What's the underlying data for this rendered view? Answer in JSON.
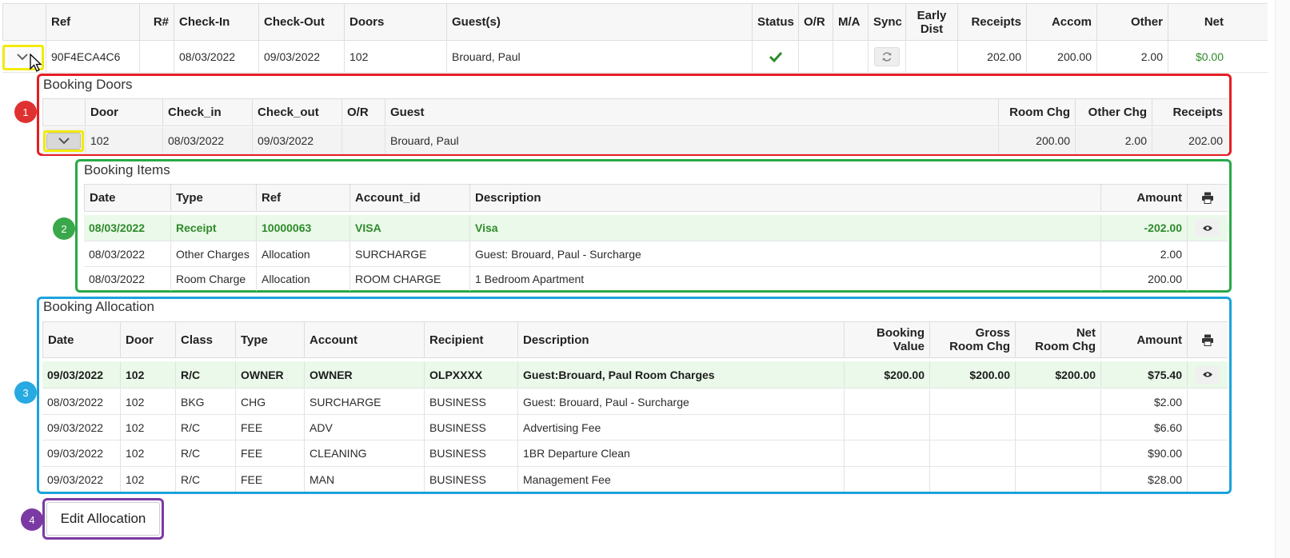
{
  "colors": {
    "red": "#e61d24",
    "green": "#2aa84a",
    "blue": "#1aa3dc",
    "purple": "#7b3aa3",
    "yellow": "#f2ea0c",
    "net_green": "#2f8a2b"
  },
  "main": {
    "headers": {
      "ref": "Ref",
      "rnum": "R#",
      "checkin": "Check-In",
      "checkout": "Check-Out",
      "doors": "Doors",
      "guests": "Guest(s)",
      "status": "Status",
      "or": "O/R",
      "ma": "M/A",
      "sync": "Sync",
      "early1": "Early",
      "early2": "Dist",
      "receipts": "Receipts",
      "accom": "Accom",
      "other": "Other",
      "net": "Net"
    },
    "row": {
      "ref": "90F4ECA4C6",
      "rnum": "",
      "checkin": "08/03/2022",
      "checkout": "09/03/2022",
      "doors": "102",
      "guests": "Brouard, Paul",
      "receipts": "202.00",
      "accom": "200.00",
      "other": "2.00",
      "net": "$0.00"
    }
  },
  "booking_doors": {
    "title": "Booking Doors",
    "headers": {
      "door": "Door",
      "check_in": "Check_in",
      "check_out": "Check_out",
      "or": "O/R",
      "guest": "Guest",
      "room_chg": "Room Chg",
      "other_chg": "Other Chg",
      "receipts": "Receipts"
    },
    "row": {
      "door": "102",
      "check_in": "08/03/2022",
      "check_out": "09/03/2022",
      "or": "",
      "guest": "Brouard, Paul",
      "room_chg": "200.00",
      "other_chg": "2.00",
      "receipts": "202.00"
    }
  },
  "booking_items": {
    "title": "Booking Items",
    "headers": {
      "date": "Date",
      "type": "Type",
      "ref": "Ref",
      "account_id": "Account_id",
      "description": "Description",
      "amount": "Amount"
    },
    "rows": [
      {
        "date": "08/03/2022",
        "type": "Receipt",
        "ref": "10000063",
        "account_id": "VISA",
        "description": "Visa",
        "amount": "-202.00"
      },
      {
        "date": "08/03/2022",
        "type": "Other Charges",
        "ref": "Allocation",
        "account_id": "SURCHARGE",
        "description": "Guest: Brouard, Paul - Surcharge",
        "amount": "2.00"
      },
      {
        "date": "08/03/2022",
        "type": "Room Charge",
        "ref": "Allocation",
        "account_id": "ROOM CHARGE",
        "description": "1 Bedroom Apartment",
        "amount": "200.00"
      }
    ]
  },
  "booking_allocation": {
    "title": "Booking Allocation",
    "headers": {
      "date": "Date",
      "door": "Door",
      "class": "Class",
      "type": "Type",
      "account": "Account",
      "recipient": "Recipient",
      "description": "Description",
      "bv1": "Booking",
      "bv2": "Value",
      "grc1": "Gross",
      "grc2": "Room Chg",
      "nrc1": "Net",
      "nrc2": "Room Chg",
      "amount": "Amount"
    },
    "rows": [
      {
        "date": "09/03/2022",
        "door": "102",
        "class": "R/C",
        "type": "OWNER",
        "account": "OWNER",
        "recipient": "OLPXXXX",
        "description": "Guest:Brouard, Paul Room Charges",
        "booking_value": "$200.00",
        "gross": "$200.00",
        "net": "$200.00",
        "amount": "$75.40"
      },
      {
        "date": "08/03/2022",
        "door": "102",
        "class": "BKG",
        "type": "CHG",
        "account": "SURCHARGE",
        "recipient": "BUSINESS",
        "description": "Guest: Brouard, Paul - Surcharge",
        "booking_value": "",
        "gross": "",
        "net": "",
        "amount": "$2.00"
      },
      {
        "date": "09/03/2022",
        "door": "102",
        "class": "R/C",
        "type": "FEE",
        "account": "ADV",
        "recipient": "BUSINESS",
        "description": "Advertising Fee",
        "booking_value": "",
        "gross": "",
        "net": "",
        "amount": "$6.60"
      },
      {
        "date": "09/03/2022",
        "door": "102",
        "class": "R/C",
        "type": "FEE",
        "account": "CLEANING",
        "recipient": "BUSINESS",
        "description": "1BR Departure Clean",
        "booking_value": "",
        "gross": "",
        "net": "",
        "amount": "$90.00"
      },
      {
        "date": "09/03/2022",
        "door": "102",
        "class": "R/C",
        "type": "FEE",
        "account": "MAN",
        "recipient": "BUSINESS",
        "description": "Management Fee",
        "booking_value": "",
        "gross": "",
        "net": "",
        "amount": "$28.00"
      }
    ]
  },
  "edit_allocation": {
    "label": "Edit Allocation"
  },
  "badges": [
    "1",
    "2",
    "3",
    "4"
  ]
}
